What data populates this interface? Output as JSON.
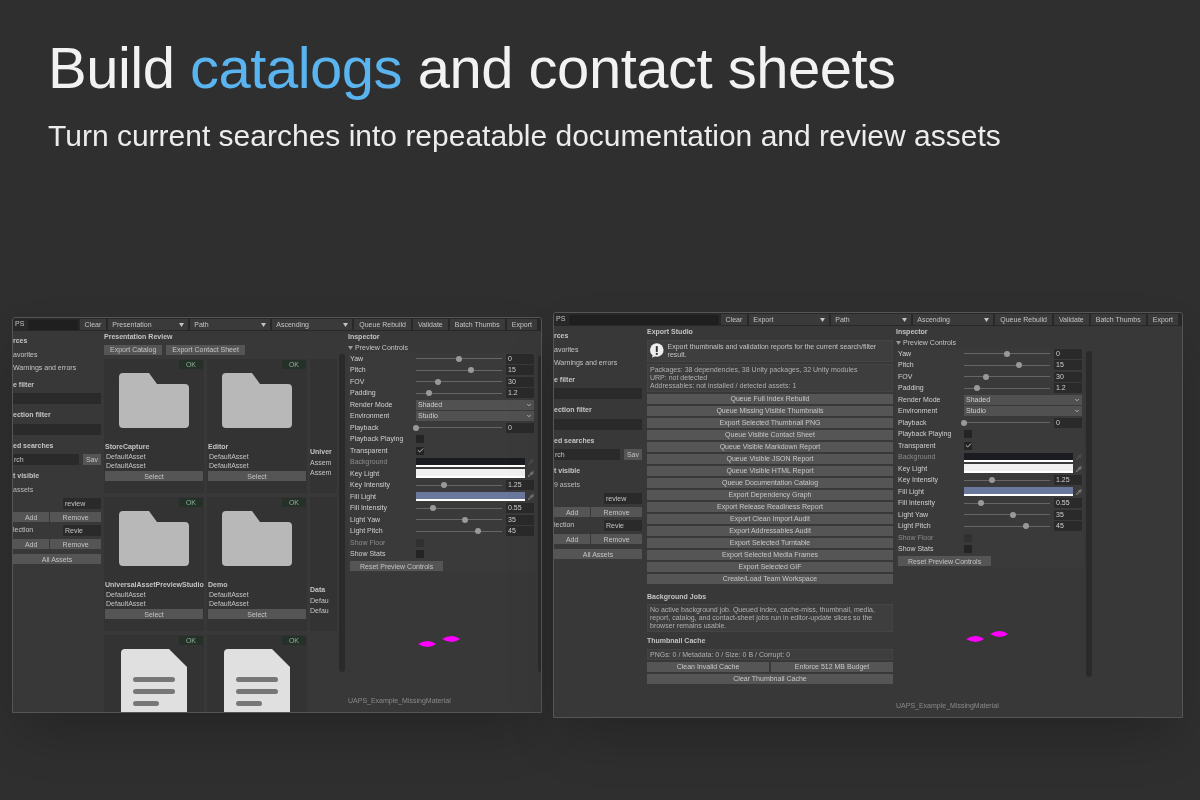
{
  "headline": [
    {
      "text": "Build ",
      "accent": false
    },
    {
      "text": "catalogs",
      "accent": true
    },
    {
      "text": " and contact sheets",
      "accent": false
    }
  ],
  "subtitle": "Turn current searches into repeatable documentation and review assets",
  "windows": [
    {
      "toolbar": [
        {
          "kind": "label",
          "text": "PS"
        },
        {
          "kind": "search"
        },
        {
          "kind": "button",
          "text": "Clear"
        },
        {
          "kind": "dropdown",
          "text": "Presentation"
        },
        {
          "kind": "dropdown",
          "text": "Path"
        },
        {
          "kind": "dropdown",
          "text": "Ascending"
        },
        {
          "kind": "button",
          "text": "Queue Rebuild"
        },
        {
          "kind": "button",
          "text": "Validate"
        },
        {
          "kind": "button",
          "text": "Batch Thumbs"
        },
        {
          "kind": "button",
          "text": "Export"
        }
      ],
      "sidebar": [
        {
          "kind": "header",
          "text": "rces"
        },
        {
          "kind": "item",
          "text": "avorites"
        },
        {
          "kind": "item",
          "text": "Warnings and errors"
        },
        {
          "kind": "header",
          "text": "e filter"
        },
        {
          "kind": "field"
        },
        {
          "kind": "header",
          "text": "ection filter"
        },
        {
          "kind": "field"
        },
        {
          "kind": "header",
          "text": "ed searches"
        },
        {
          "kind": "field_button",
          "value": "rch",
          "button": "Sav"
        },
        {
          "kind": "header",
          "text": "t visible"
        },
        {
          "kind": "note",
          "text": "assets"
        },
        {
          "kind": "label_field",
          "value": "review"
        },
        {
          "kind": "pair",
          "buttons": [
            "Add",
            "Remove"
          ]
        },
        {
          "kind": "label_field",
          "label": "lection",
          "value": "Revie"
        },
        {
          "kind": "pair",
          "buttons": [
            "Add",
            "Remove"
          ]
        },
        {
          "kind": "button",
          "text": "All Assets"
        }
      ],
      "main": {
        "kind": "grid",
        "title": "Presentation Review",
        "buttons": [
          "Export Catalog",
          "Export Contact Sheet"
        ],
        "rows": [
          [
            {
              "kind": "folder",
              "badge": "OK",
              "name": "StoreCapture",
              "lines": [
                "DefaultAsset",
                "DefaultAsset"
              ],
              "button": "Select"
            },
            {
              "kind": "folder",
              "badge": "OK",
              "name": "Editor",
              "lines": [
                "DefaultAsset",
                "DefaultAsset"
              ],
              "button": "Select"
            },
            {
              "kind": "partial",
              "name": "Univer",
              "lines": [
                "Assem",
                "Assem"
              ]
            }
          ],
          [
            {
              "kind": "folder",
              "badge": "OK",
              "name": "UniversalAssetPreviewStudio",
              "lines": [
                "DefaultAsset",
                "DefaultAsset"
              ],
              "button": "Select"
            },
            {
              "kind": "folder",
              "badge": "OK",
              "name": "Demo",
              "lines": [
                "DefaultAsset",
                "DefaultAsset"
              ],
              "button": "Select"
            },
            {
              "kind": "partial",
              "name": "Data",
              "lines": [
                "Defau",
                "Defau"
              ]
            }
          ],
          [
            {
              "kind": "doc",
              "badge": "OK"
            },
            {
              "kind": "doc",
              "badge": "OK"
            }
          ]
        ]
      },
      "inspector": {
        "title": "Inspector",
        "section": "Preview Controls",
        "reset": "Reset Preview Controls",
        "asset": "UAPS_Example_MissingMaterial",
        "rows": [
          {
            "kind": "slider",
            "label": "Yaw",
            "level": 0.5,
            "value": "0",
            "disabled": false
          },
          {
            "kind": "slider",
            "label": "Pitch",
            "level": 0.64,
            "value": "15",
            "disabled": false
          },
          {
            "kind": "slider",
            "label": "FOV",
            "level": 0.26,
            "value": "30",
            "disabled": false
          },
          {
            "kind": "slider",
            "label": "Padding",
            "level": 0.15,
            "value": "1.2",
            "disabled": false
          },
          {
            "kind": "dropdown",
            "label": "Render Mode",
            "value": "Shaded",
            "disabled": false
          },
          {
            "kind": "dropdown",
            "label": "Environment",
            "value": "Studio",
            "disabled": false
          },
          {
            "kind": "slider",
            "label": "Playback",
            "level": 0,
            "value": "0",
            "disabled": false
          },
          {
            "kind": "checkbox",
            "label": "Playback Playing",
            "checked": false,
            "disabled": false
          },
          {
            "kind": "checkbox",
            "label": "Transparent",
            "checked": true,
            "disabled": false
          },
          {
            "kind": "color",
            "label": "Background",
            "color": "#1b1c22",
            "disabled": true
          },
          {
            "kind": "color",
            "label": "Key Light",
            "color": "#f0f0f0",
            "disabled": false
          },
          {
            "kind": "slider",
            "label": "Key Intensity",
            "level": 0.32,
            "value": "1.25",
            "disabled": false
          },
          {
            "kind": "color",
            "label": "Fill Light",
            "color": "#6b789e",
            "disabled": false
          },
          {
            "kind": "slider",
            "label": "Fill Intensity",
            "level": 0.2,
            "value": "0.55",
            "disabled": false
          },
          {
            "kind": "slider",
            "label": "Light Yaw",
            "level": 0.57,
            "value": "35",
            "disabled": false
          },
          {
            "kind": "slider",
            "label": "Light Pitch",
            "level": 0.72,
            "value": "45",
            "disabled": false
          },
          {
            "kind": "checkbox",
            "label": "Show Floor",
            "checked": false,
            "disabled": true
          },
          {
            "kind": "checkbox",
            "label": "Show Stats",
            "checked": false,
            "disabled": false
          }
        ]
      }
    },
    {
      "toolbar": [
        {
          "kind": "label",
          "text": "PS"
        },
        {
          "kind": "search"
        },
        {
          "kind": "button",
          "text": "Clear"
        },
        {
          "kind": "dropdown",
          "text": "Export"
        },
        {
          "kind": "dropdown",
          "text": "Path"
        },
        {
          "kind": "dropdown",
          "text": "Ascending"
        },
        {
          "kind": "button",
          "text": "Queue Rebuild"
        },
        {
          "kind": "button",
          "text": "Validate"
        },
        {
          "kind": "button",
          "text": "Batch Thumbs"
        },
        {
          "kind": "button",
          "text": "Export"
        }
      ],
      "sidebar": [
        {
          "kind": "header",
          "text": "rces"
        },
        {
          "kind": "item",
          "text": "avorites"
        },
        {
          "kind": "item",
          "text": "Warnings and errors"
        },
        {
          "kind": "header",
          "text": "e filter"
        },
        {
          "kind": "field"
        },
        {
          "kind": "header",
          "text": "ection filter"
        },
        {
          "kind": "field"
        },
        {
          "kind": "header",
          "text": "ed searches"
        },
        {
          "kind": "field_button",
          "value": "rch",
          "button": "Sav"
        },
        {
          "kind": "header",
          "text": "t visible"
        },
        {
          "kind": "note",
          "text": "9 assets"
        },
        {
          "kind": "label_field",
          "value": "review"
        },
        {
          "kind": "pair",
          "buttons": [
            "Add",
            "Remove"
          ]
        },
        {
          "kind": "label_field",
          "label": "lection",
          "value": "Revie"
        },
        {
          "kind": "pair",
          "buttons": [
            "Add",
            "Remove"
          ]
        },
        {
          "kind": "button",
          "text": "All Assets"
        }
      ],
      "main": {
        "kind": "export",
        "title": "Export Studio",
        "info": "Export thumbnails and validation reports for the current search/filter result.",
        "details": [
          "Packages: 38 dependencies, 38 Unity packages, 32 Unity modules",
          "URP: not detected",
          "Addressables: not installed / detected assets: 1"
        ],
        "actions": [
          "Queue Full Index Rebuild",
          "Queue Missing Visible Thumbnails",
          "Export Selected Thumbnail PNG",
          "Queue Visible Contact Sheet",
          "Queue Visible Markdown Report",
          "Queue Visible JSON Report",
          "Queue Visible HTML Report",
          "Queue Documentation Catalog",
          "Export Dependency Graph",
          "Export Release Readiness Report",
          "Export Clean Import Audit",
          "Export Addressables Audit",
          "Export Selected Turntable",
          "Export Selected Media Frames",
          "Export Selected GIF",
          "Create/Load Team Workspace"
        ],
        "jobs": {
          "title": "Background Jobs",
          "text": "No active background job. Queued index, cache-miss, thumbnail, media, report, catalog, and contact-sheet jobs run in editor-update slices so the browser remains usable."
        },
        "cache": {
          "title": "Thumbnail Cache",
          "status": "PNGs: 0 / Metadata: 0 / Size: 0 B / Corrupt: 0",
          "row": [
            "Clean Invalid Cache",
            "Enforce 512 MB Budget"
          ],
          "button": "Clear Thumbnail Cache"
        }
      },
      "inspector": {
        "title": "Inspector",
        "section": "Preview Controls",
        "reset": "Reset Preview Controls",
        "asset": "UAPS_Example_MissingMaterial",
        "rows": [
          {
            "kind": "slider",
            "label": "Yaw",
            "level": 0.5,
            "value": "0",
            "disabled": false
          },
          {
            "kind": "slider",
            "label": "Pitch",
            "level": 0.64,
            "value": "15",
            "disabled": false
          },
          {
            "kind": "slider",
            "label": "FOV",
            "level": 0.26,
            "value": "30",
            "disabled": false
          },
          {
            "kind": "slider",
            "label": "Padding",
            "level": 0.15,
            "value": "1.2",
            "disabled": false
          },
          {
            "kind": "dropdown",
            "label": "Render Mode",
            "value": "Shaded",
            "disabled": false
          },
          {
            "kind": "dropdown",
            "label": "Environment",
            "value": "Studio",
            "disabled": false
          },
          {
            "kind": "slider",
            "label": "Playback",
            "level": 0,
            "value": "0",
            "disabled": false
          },
          {
            "kind": "checkbox",
            "label": "Playback Playing",
            "checked": false,
            "disabled": false
          },
          {
            "kind": "checkbox",
            "label": "Transparent",
            "checked": true,
            "disabled": false
          },
          {
            "kind": "color",
            "label": "Background",
            "color": "#1b1c22",
            "disabled": true
          },
          {
            "kind": "color",
            "label": "Key Light",
            "color": "#f0f0f0",
            "disabled": false
          },
          {
            "kind": "slider",
            "label": "Key Intensity",
            "level": 0.32,
            "value": "1.25",
            "disabled": false
          },
          {
            "kind": "color",
            "label": "Fill Light",
            "color": "#6b789e",
            "disabled": false
          },
          {
            "kind": "slider",
            "label": "Fill Intensity",
            "level": 0.2,
            "value": "0.55",
            "disabled": false
          },
          {
            "kind": "slider",
            "label": "Light Yaw",
            "level": 0.57,
            "value": "35",
            "disabled": false
          },
          {
            "kind": "slider",
            "label": "Light Pitch",
            "level": 0.72,
            "value": "45",
            "disabled": false
          },
          {
            "kind": "checkbox",
            "label": "Show Floor",
            "checked": false,
            "disabled": true
          },
          {
            "kind": "checkbox",
            "label": "Show Stats",
            "checked": false,
            "disabled": false
          }
        ]
      }
    }
  ]
}
